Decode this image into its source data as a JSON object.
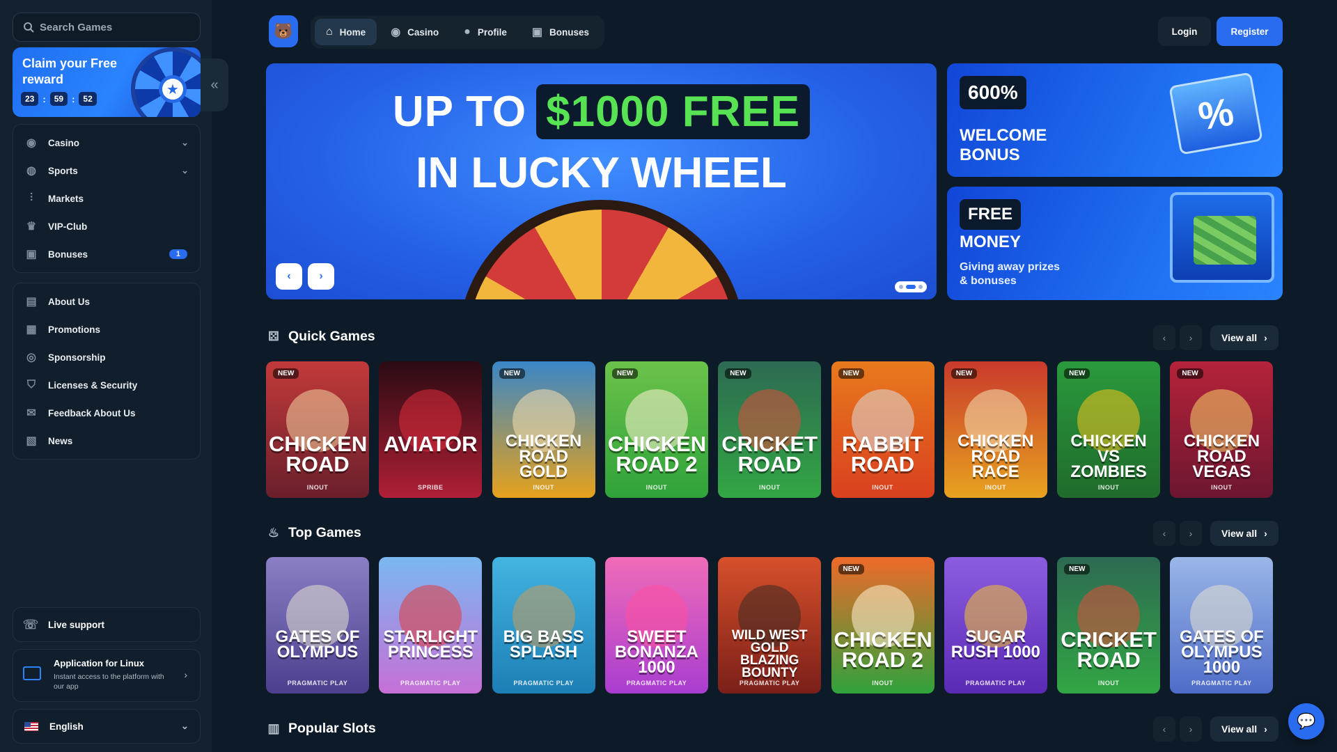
{
  "search": {
    "placeholder": "Search Games"
  },
  "reward": {
    "title": "Claim your Free reward",
    "timer": [
      "23",
      "59",
      "52"
    ]
  },
  "sidebar": {
    "main": [
      {
        "label": "Casino",
        "icon": "casino-chip-icon",
        "expandable": true
      },
      {
        "label": "Sports",
        "icon": "globe-icon",
        "expandable": true
      },
      {
        "label": "Markets",
        "icon": "candles-icon"
      },
      {
        "label": "VIP-Club",
        "icon": "crown-icon"
      },
      {
        "label": "Bonuses",
        "icon": "gift-icon",
        "badge": "1"
      }
    ],
    "info": [
      {
        "label": "About Us",
        "icon": "book-icon"
      },
      {
        "label": "Promotions",
        "icon": "tickets-icon"
      },
      {
        "label": "Sponsorship",
        "icon": "medal-icon"
      },
      {
        "label": "Licenses & Security",
        "icon": "shield-icon"
      },
      {
        "label": "Feedback About Us",
        "icon": "chat-icon"
      },
      {
        "label": "News",
        "icon": "newspaper-icon"
      }
    ],
    "live_support": "Live support",
    "app": {
      "title": "Application for Linux",
      "subtitle": "Instant access to the platform with our app"
    },
    "language": "English"
  },
  "nav": {
    "items": [
      {
        "label": "Home",
        "active": true
      },
      {
        "label": "Casino"
      },
      {
        "label": "Profile"
      },
      {
        "label": "Bonuses"
      }
    ],
    "login": "Login",
    "register": "Register"
  },
  "hero": {
    "pre": "UP TO",
    "highlight": "$1000 FREE",
    "line2": "IN LUCKY WHEEL"
  },
  "banners": [
    {
      "tag": "600%",
      "title": "WELCOME BONUS"
    },
    {
      "tag": "FREE",
      "title": "MONEY",
      "subtitle": "Giving away prizes & bonuses"
    }
  ],
  "sections": [
    {
      "title": "Quick Games",
      "view_all": "View all",
      "games": [
        {
          "name": "CHICKEN ROAD",
          "provider": "INOUT",
          "new": true,
          "bg": "#c23a3a",
          "bg2": "#6a1f2c",
          "art": "#f4d5a0"
        },
        {
          "name": "AVIATOR",
          "provider": "SPRIBE",
          "new": false,
          "bg": "#2a0b12",
          "bg2": "#b01f36",
          "art": "#e02b3d"
        },
        {
          "name": "CHICKEN ROAD GOLD",
          "provider": "INOUT",
          "new": true,
          "bg": "#3a86c7",
          "bg2": "#e6a11c",
          "art": "#f8e0b0"
        },
        {
          "name": "CHICKEN ROAD 2",
          "provider": "INOUT",
          "new": true,
          "bg": "#6bc24a",
          "bg2": "#2fa33a",
          "art": "#fff2d6"
        },
        {
          "name": "CRICKET ROAD",
          "provider": "INOUT",
          "new": true,
          "bg": "#2d6a52",
          "bg2": "#32a644",
          "art": "#e24d3a"
        },
        {
          "name": "RABBIT ROAD",
          "provider": "INOUT",
          "new": true,
          "bg": "#e87a1e",
          "bg2": "#d9401f",
          "art": "#dcdcdc"
        },
        {
          "name": "CHICKEN ROAD RACE",
          "provider": "INOUT",
          "new": true,
          "bg": "#c93a2c",
          "bg2": "#e7a21f",
          "art": "#f4e2b5"
        },
        {
          "name": "CHICKEN VS ZOMBIES",
          "provider": "INOUT",
          "new": true,
          "bg": "#2a9a3c",
          "bg2": "#1f6b2c",
          "art": "#f6c21e"
        },
        {
          "name": "CHICKEN ROAD VEGAS",
          "provider": "INOUT",
          "new": true,
          "bg": "#b5233a",
          "bg2": "#6d1630",
          "art": "#f7d36a"
        }
      ]
    },
    {
      "title": "Top Games",
      "view_all": "View all",
      "games": [
        {
          "name": "GATES OF OLYMPUS",
          "provider": "PRAGMATIC PLAY",
          "new": false,
          "bg": "#8a7fc4",
          "bg2": "#4b3f8e",
          "art": "#e6e0d0"
        },
        {
          "name": "STARLIGHT PRINCESS",
          "provider": "PRAGMATIC PLAY",
          "new": false,
          "bg": "#7ab8f0",
          "bg2": "#c66fd6",
          "art": "#e23b3b"
        },
        {
          "name": "BIG BASS SPLASH",
          "provider": "PRAGMATIC PLAY",
          "new": false,
          "bg": "#43b4e0",
          "bg2": "#1d7fb5",
          "art": "#c99a5a"
        },
        {
          "name": "SWEET BONANZA 1000",
          "provider": "PRAGMATIC PLAY",
          "new": false,
          "bg": "#f06cb8",
          "bg2": "#a93dd0",
          "art": "#ff4f9e"
        },
        {
          "name": "WILD WEST GOLD BLAZING BOUNTY",
          "provider": "PRAGMATIC PLAY",
          "new": false,
          "bg": "#d6502a",
          "bg2": "#7a1f19",
          "art": "#3a2a22"
        },
        {
          "name": "CHICKEN ROAD 2",
          "provider": "INOUT",
          "new": true,
          "bg": "#ee6a2a",
          "bg2": "#30a23c",
          "art": "#fff2d6"
        },
        {
          "name": "SUGAR RUSH 1000",
          "provider": "PRAGMATIC PLAY",
          "new": false,
          "bg": "#8c5ce0",
          "bg2": "#5a2ab5",
          "art": "#f2c22e"
        },
        {
          "name": "CRICKET ROAD",
          "provider": "INOUT",
          "new": true,
          "bg": "#2d6a52",
          "bg2": "#32a644",
          "art": "#e24d3a"
        },
        {
          "name": "GATES OF OLYMPUS 1000",
          "provider": "PRAGMATIC PLAY",
          "new": false,
          "bg": "#9ab6e8",
          "bg2": "#4e6cc8",
          "art": "#e6e0d0"
        }
      ]
    },
    {
      "title": "Popular Slots",
      "view_all": "View all"
    }
  ],
  "colors": {
    "accent": "#2a6cf0",
    "background": "#0d1b29",
    "sidebar": "#14222f",
    "hero_highlight": "#57e354"
  }
}
